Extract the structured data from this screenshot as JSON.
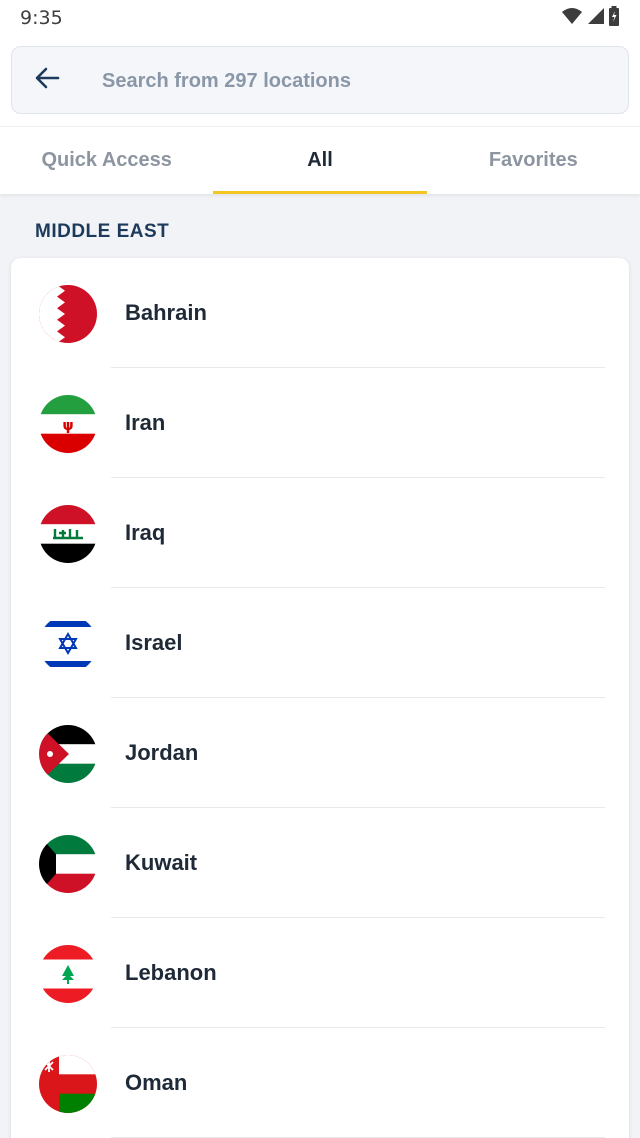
{
  "status_bar": {
    "time": "9:35",
    "icons": [
      "wifi-icon",
      "signal-icon",
      "battery-icon"
    ]
  },
  "search": {
    "placeholder": "Search from 297 locations",
    "back_icon": "arrow-left-icon"
  },
  "tabs": [
    {
      "label": "Quick Access",
      "active": false
    },
    {
      "label": "All",
      "active": true
    },
    {
      "label": "Favorites",
      "active": false
    }
  ],
  "section": {
    "title": "MIDDLE EAST"
  },
  "countries": [
    {
      "name": "Bahrain",
      "flag": "bahrain-flag-icon"
    },
    {
      "name": "Iran",
      "flag": "iran-flag-icon"
    },
    {
      "name": "Iraq",
      "flag": "iraq-flag-icon"
    },
    {
      "name": "Israel",
      "flag": "israel-flag-icon"
    },
    {
      "name": "Jordan",
      "flag": "jordan-flag-icon"
    },
    {
      "name": "Kuwait",
      "flag": "kuwait-flag-icon"
    },
    {
      "name": "Lebanon",
      "flag": "lebanon-flag-icon"
    },
    {
      "name": "Oman",
      "flag": "oman-flag-icon"
    }
  ],
  "colors": {
    "accent": "#f3c622",
    "section_title": "#1d3a5c",
    "text_primary": "#1f2a38",
    "text_muted": "#8d95a0"
  }
}
